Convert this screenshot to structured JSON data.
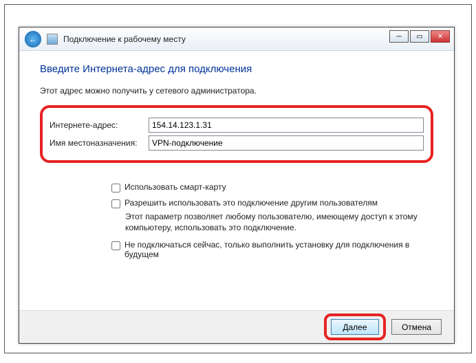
{
  "window": {
    "title": "Подключение к рабочему месту"
  },
  "heading": "Введите Интернета-адрес для подключения",
  "subtext": "Этот адрес можно получить у сетевого администратора.",
  "fields": {
    "address_label": "Интернете-адрес:",
    "address_value": "154.14.123.1.31",
    "destination_label": "Имя местоназначения:",
    "destination_value": "VPN-подключение"
  },
  "options": {
    "smartcard": "Использовать смарт-карту",
    "allow_others": "Разрешить использовать это подключение другим пользователям",
    "allow_others_desc": "Этот параметр позволяет любому пользователю, имеющему доступ к этому компьютеру, использовать это подключение.",
    "dont_connect": "Не подключаться сейчас, только выполнить установку для подключения в будущем"
  },
  "buttons": {
    "next": "Далее",
    "cancel": "Отмена"
  }
}
